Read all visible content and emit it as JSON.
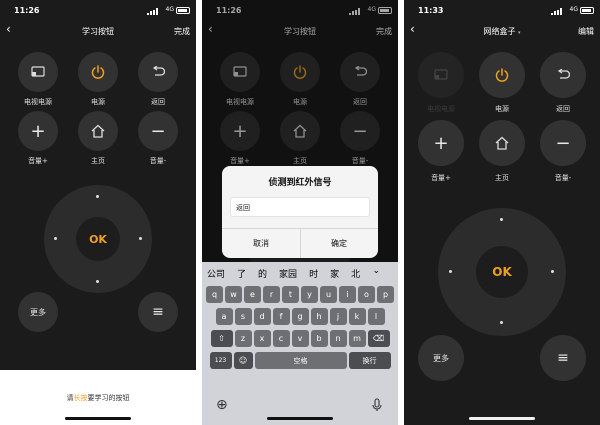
{
  "phone1": {
    "status": {
      "time": "11:26",
      "network": "4G"
    },
    "nav": {
      "back": "‹",
      "title": "学习按钮",
      "right": "完成"
    },
    "buttons": {
      "tv_power": {
        "label": "电视电源",
        "icon": "tv-input-icon"
      },
      "power": {
        "label": "电源",
        "icon": "power-icon"
      },
      "back": {
        "label": "返回",
        "icon": "return-icon"
      },
      "vol_up": {
        "label": "音量+",
        "glyph": "+"
      },
      "home": {
        "label": "主页",
        "icon": "home-icon"
      },
      "vol_down": {
        "label": "音量-",
        "glyph": "−"
      },
      "more": {
        "label": "更多"
      },
      "menu": {
        "glyph": "≡"
      }
    },
    "ok": "OK",
    "hint": {
      "pre": "请",
      "highlight": "长按",
      "post": "要学习的按钮"
    }
  },
  "phone2": {
    "status": {
      "time": "11:26",
      "network": "4G"
    },
    "nav": {
      "back": "‹",
      "title": "学习按钮",
      "right": "完成"
    },
    "buttons": {
      "tv_power": {
        "label": "电视电源"
      },
      "power": {
        "label": "电源"
      },
      "back": {
        "label": "返回"
      },
      "vol_up": {
        "label": "音量+",
        "glyph": "+"
      },
      "home": {
        "label": "主页"
      },
      "vol_down": {
        "label": "音量-",
        "glyph": "−"
      }
    },
    "dialog": {
      "title": "侦测到红外信号",
      "input_value": "返回",
      "cancel": "取消",
      "confirm": "确定"
    },
    "keyboard": {
      "suggestions": [
        "公司",
        "了",
        "的",
        "家园",
        "时",
        "家",
        "北"
      ],
      "suggest_caret": "⌄",
      "row1": [
        "q",
        "w",
        "e",
        "r",
        "t",
        "y",
        "u",
        "i",
        "o",
        "p"
      ],
      "row2": [
        "a",
        "s",
        "d",
        "f",
        "g",
        "h",
        "j",
        "k",
        "l"
      ],
      "row3": [
        "z",
        "x",
        "c",
        "v",
        "b",
        "n",
        "m"
      ],
      "shift": "⇧",
      "delete": "⌫",
      "num": "123",
      "emoji": "☺",
      "space": "空格",
      "return": "换行",
      "globe": "⊕",
      "mic": "🎤"
    }
  },
  "phone3": {
    "status": {
      "time": "11:33",
      "network": "4G"
    },
    "nav": {
      "back": "‹",
      "title": "网络盒子",
      "title_caret": "▾",
      "right": "编辑"
    },
    "buttons": {
      "tv_power": {
        "label": "电视电源",
        "disabled": true
      },
      "power": {
        "label": "电源"
      },
      "back": {
        "label": "返回"
      },
      "vol_up": {
        "label": "音量+",
        "glyph": "+"
      },
      "home": {
        "label": "主页"
      },
      "vol_down": {
        "label": "音量-",
        "glyph": "−"
      },
      "more": {
        "label": "更多"
      },
      "menu": {
        "glyph": "≡"
      }
    },
    "ok": "OK"
  },
  "colors": {
    "accent": "#f0a020",
    "background": "#1b1b1b",
    "button": "#323232"
  }
}
